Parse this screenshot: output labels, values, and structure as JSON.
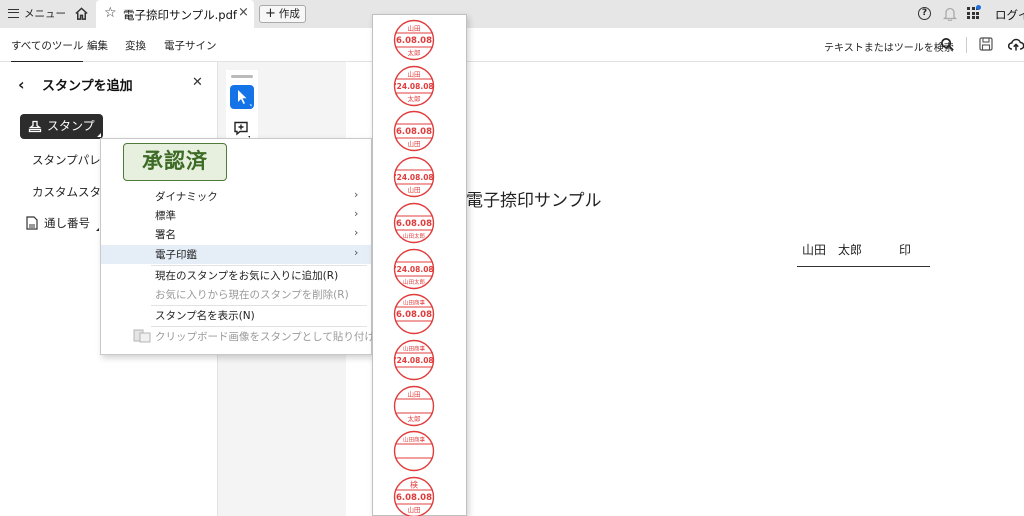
{
  "tabbar": {
    "menu_label": "メニュー",
    "tab_title": "電子捺印サンプル.pdf",
    "new_label": "作成",
    "login_label": "ログイン"
  },
  "tools": {
    "tabs": [
      "すべてのツール",
      "編集",
      "変換",
      "電子サイン"
    ],
    "search_label": "テキストまたはツールを検索"
  },
  "panel": {
    "title": "スタンプを追加",
    "stamp_button": "スタンプ",
    "items": [
      "スタンプパレット",
      "カスタムスタンプ",
      "通し番号"
    ]
  },
  "context_menu": {
    "preview_label": "承認済",
    "items": [
      {
        "label": "ダイナミック",
        "submenu": true,
        "state": "normal"
      },
      {
        "label": "標準",
        "submenu": true,
        "state": "normal"
      },
      {
        "label": "署名",
        "submenu": true,
        "state": "normal"
      },
      {
        "label": "電子印鑑",
        "submenu": true,
        "state": "highlighted"
      },
      {
        "label": "現在のスタンプをお気に入りに追加(R)",
        "submenu": false,
        "state": "normal"
      },
      {
        "label": "お気に入りから現在のスタンプを削除(R)",
        "submenu": false,
        "state": "disabled"
      },
      {
        "label": "スタンプ名を表示(N)",
        "submenu": false,
        "state": "normal"
      },
      {
        "label": "クリップボード画像をスタンプとして貼り付け(D)",
        "submenu": false,
        "state": "disabled"
      }
    ]
  },
  "stamp_submenu": {
    "stamps": [
      {
        "top": "山田",
        "mid": "6.08.08",
        "bot": "太郎"
      },
      {
        "top": "山田",
        "mid": "'24.08.08",
        "bot": "太郎"
      },
      {
        "top": "",
        "mid": "6.08.08",
        "bot": "山田"
      },
      {
        "top": "",
        "mid": "'24.08.08",
        "bot": "山田"
      },
      {
        "top": "",
        "mid": "6.08.08",
        "bot": "山田太郎"
      },
      {
        "top": "",
        "mid": "'24.08.08",
        "bot": "山田太郎"
      },
      {
        "top": "山田商事",
        "mid": "6.08.08",
        "bot": ""
      },
      {
        "top": "山田商事",
        "mid": "'24.08.08",
        "bot": ""
      },
      {
        "top": "山田",
        "mid": "",
        "bot": "太郎"
      },
      {
        "top": "山田商事",
        "mid": "",
        "bot": ""
      },
      {
        "top": "検",
        "mid": "6.08.08",
        "bot": "山田"
      }
    ]
  },
  "document": {
    "title": "電子捺印サンプル",
    "signature_name": "山田　太郎",
    "seal_label": "印"
  },
  "colors": {
    "stamp_red": "#e03c3c",
    "accent_blue": "#1473e6",
    "approved_green": "#3d6b26",
    "menu_highlight": "#e5edf7"
  }
}
